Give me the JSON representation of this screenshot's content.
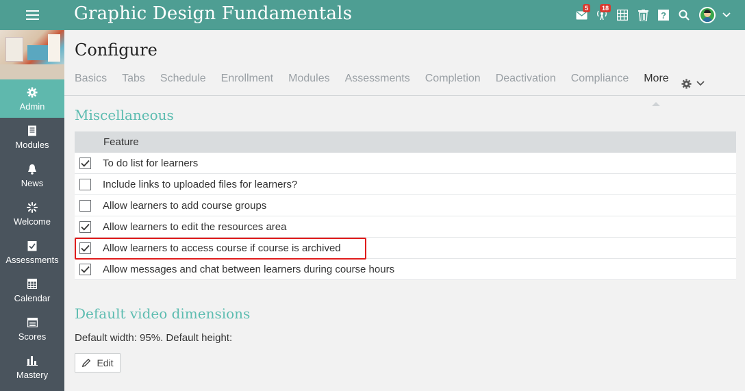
{
  "app": {
    "title": "Graphic Design Fundamentals",
    "accent_color": "#4e9e93",
    "notifications": [
      {
        "icon": "mail-icon",
        "count": "5"
      },
      {
        "icon": "broadcast-icon",
        "count": "18"
      }
    ],
    "header_icons": [
      "mail-icon",
      "broadcast-icon",
      "calendar-grid-icon",
      "trash-icon",
      "help-icon",
      "search-icon",
      "avatar",
      "chevron-down-icon"
    ]
  },
  "sidebar": {
    "items": [
      {
        "label": "Admin",
        "icon": "gear-icon",
        "active": true
      },
      {
        "label": "Modules",
        "icon": "book-icon"
      },
      {
        "label": "News",
        "icon": "bell-icon"
      },
      {
        "label": "Welcome",
        "icon": "sparkle-icon"
      },
      {
        "label": "Assessments",
        "icon": "checklist-icon"
      },
      {
        "label": "Calendar",
        "icon": "calendar-icon"
      },
      {
        "label": "Scores",
        "icon": "scores-icon"
      },
      {
        "label": "Mastery",
        "icon": "bar-chart-icon"
      }
    ]
  },
  "page": {
    "title": "Configure",
    "tabs": [
      "Basics",
      "Tabs",
      "Schedule",
      "Enrollment",
      "Modules",
      "Assessments",
      "Completion",
      "Deactivation",
      "Compliance",
      "More"
    ],
    "current_tab": "More"
  },
  "misc": {
    "title": "Miscellaneous",
    "header": "Feature",
    "rows": [
      {
        "label": "To do list for learners",
        "checked": true
      },
      {
        "label": "Include links to uploaded files for learners?",
        "checked": false
      },
      {
        "label": "Allow learners to add course groups",
        "checked": false
      },
      {
        "label": "Allow learners to edit the resources area",
        "checked": true
      },
      {
        "label": "Allow learners to access course if course is archived",
        "checked": true,
        "highlighted": true
      },
      {
        "label": "Allow messages and chat between learners during course hours",
        "checked": true
      }
    ]
  },
  "video": {
    "title": "Default video dimensions",
    "text": "Default width: 95%. Default height:",
    "edit_label": "Edit"
  }
}
